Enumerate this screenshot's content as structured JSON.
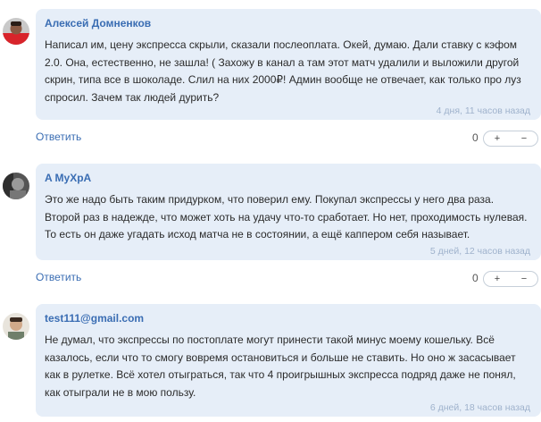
{
  "comments": [
    {
      "author": "Алексей Домненков",
      "text": "Написал им, цену экспресса скрыли, сказали послеоплата. Окей, думаю. Дали ставку с кэфом 2.0. Она, естественно, не зашла! ( Захожу в канал а там этот матч удалили и выложили другой скрин, типа все в шоколаде. Слил на них 2000₽! Админ вообще не отвечает, как только про луз спросил. Зачем так людей дурить?",
      "time": "4 дня, 11 часов назад",
      "reply": "Ответить",
      "votes": "0",
      "plus": "+",
      "minus": "−"
    },
    {
      "author": "A MyXpA",
      "text": "Это же надо быть таким придурком, что поверил ему. Покупал экспрессы у него два раза. Второй раз в надежде, что может хоть на удачу что-то сработает. Но нет, проходимость нулевая. То есть он даже угадать исход матча не в состоянии, а ещё каппером себя называет.",
      "time": "5 дней, 12 часов назад",
      "reply": "Ответить",
      "votes": "0",
      "plus": "+",
      "minus": "−"
    },
    {
      "author": "test111@gmail.com",
      "text": "Не думал, что экспрессы по постоплате могут принести такой минус моему кошельку. Всё казалось, если что то смогу вовремя остановиться и больше не ставить. Но оно ж засасывает как в рулетке. Всё хотел отыграться, так что 4 проигрышных экспресса подряд даже не понял, как отыграли не в мою пользу.",
      "time": "6 дней, 18 часов назад"
    }
  ]
}
